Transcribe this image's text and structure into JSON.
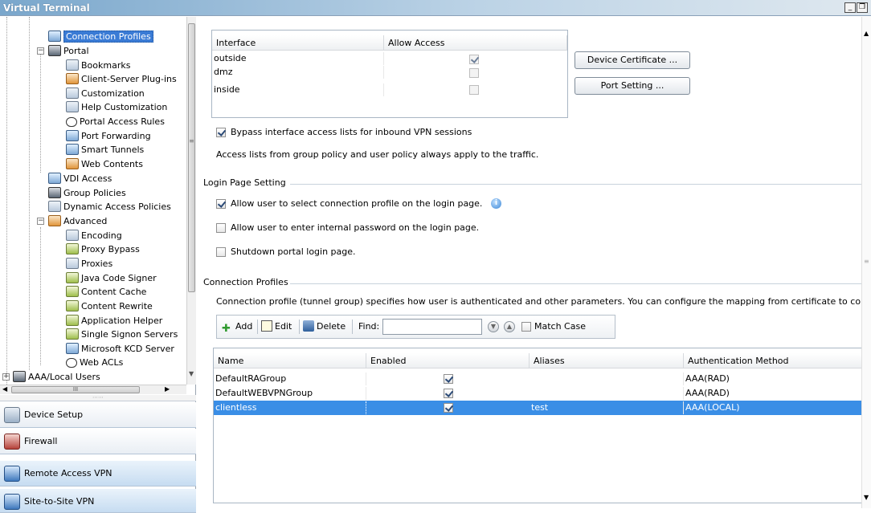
{
  "window": {
    "title": "Virtual Terminal",
    "minimize_label": "_",
    "restore_label": "❐"
  },
  "nav": {
    "tree": [
      {
        "label": "Connection Profiles",
        "selected": true
      },
      {
        "label": "Portal"
      },
      {
        "label": "Bookmarks"
      },
      {
        "label": "Client-Server Plug-ins"
      },
      {
        "label": "Customization"
      },
      {
        "label": "Help Customization"
      },
      {
        "label": "Portal Access Rules"
      },
      {
        "label": "Port Forwarding"
      },
      {
        "label": "Smart Tunnels"
      },
      {
        "label": "Web Contents"
      },
      {
        "label": "VDI Access"
      },
      {
        "label": "Group Policies"
      },
      {
        "label": "Dynamic Access Policies"
      },
      {
        "label": "Advanced"
      },
      {
        "label": "Encoding"
      },
      {
        "label": "Proxy Bypass"
      },
      {
        "label": "Proxies"
      },
      {
        "label": "Java Code Signer"
      },
      {
        "label": "Content Cache"
      },
      {
        "label": "Content Rewrite"
      },
      {
        "label": "Application Helper"
      },
      {
        "label": "Single Signon Servers"
      },
      {
        "label": "Microsoft KCD Server"
      },
      {
        "label": "Web ACLs"
      },
      {
        "label": "AAA/Local Users"
      }
    ],
    "hscroll_grip": "III",
    "buttons": [
      {
        "label": "Device Setup",
        "accel": "D"
      },
      {
        "label": "Firewall",
        "accel": "F"
      },
      {
        "label": "Remote Access VPN",
        "accel": "R"
      },
      {
        "label": "Site-to-Site VPN",
        "accel": "S"
      }
    ]
  },
  "interfaces": {
    "headers": [
      "Interface",
      "Allow Access"
    ],
    "rows": [
      {
        "name": "outside",
        "allow": true
      },
      {
        "name": "dmz",
        "allow": false
      },
      {
        "name": "inside",
        "allow": false
      }
    ],
    "device_certificate_button": "Device Certificate ...",
    "port_setting_button": "Port Setting ..."
  },
  "bypass": {
    "label": "Bypass interface access lists for inbound VPN sessions",
    "checked": true,
    "note": "Access lists from group policy and user policy always apply to the traffic."
  },
  "login_page": {
    "section_title": "Login Page Setting",
    "options": [
      {
        "label": "Allow user to select connection profile on the login page.",
        "checked": true
      },
      {
        "label": "Allow user to enter internal password on the login page.",
        "checked": false
      },
      {
        "label": "Shutdown portal login page.",
        "checked": false
      }
    ]
  },
  "profiles": {
    "section_title": "Connection Profiles",
    "description": "Connection profile (tunnel group) specifies how user is authenticated and other parameters. You can configure the mapping from certificate to connecti",
    "toolbar": {
      "add": "Add",
      "edit": "Edit",
      "delete": "Delete",
      "find_label": "Find:",
      "find_value": "",
      "match_case": "Match Case"
    },
    "headers": [
      "Name",
      "Enabled",
      "Aliases",
      "Authentication Method"
    ],
    "rows": [
      {
        "name": "DefaultRAGroup",
        "enabled": true,
        "aliases": "",
        "auth": "AAA(RAD)",
        "selected": false
      },
      {
        "name": "DefaultWEBVPNGroup",
        "enabled": true,
        "aliases": "",
        "auth": "AAA(RAD)",
        "selected": false
      },
      {
        "name": "clientless",
        "enabled": true,
        "aliases": "test",
        "auth": "AAA(LOCAL)",
        "selected": true
      }
    ]
  },
  "colors": {
    "selection": "#3a8ee6",
    "titlebar": "#7aa7cc"
  }
}
